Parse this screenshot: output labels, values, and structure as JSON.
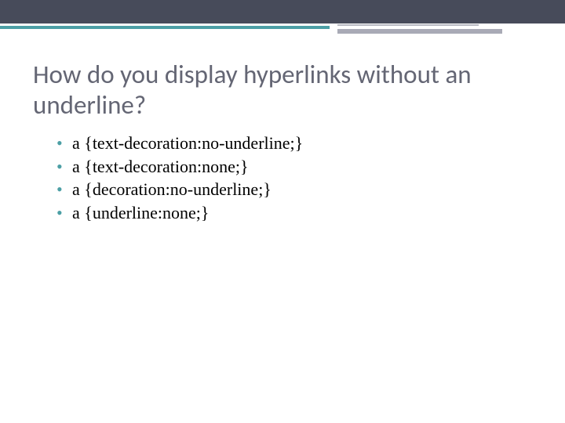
{
  "slide": {
    "title": "How do you display hyperlinks without an underline?",
    "options": [
      "a {text-decoration:no-underline;}",
      "a {text-decoration:none;}",
      "a {decoration:no-underline;}",
      "a {underline:none;}"
    ]
  }
}
